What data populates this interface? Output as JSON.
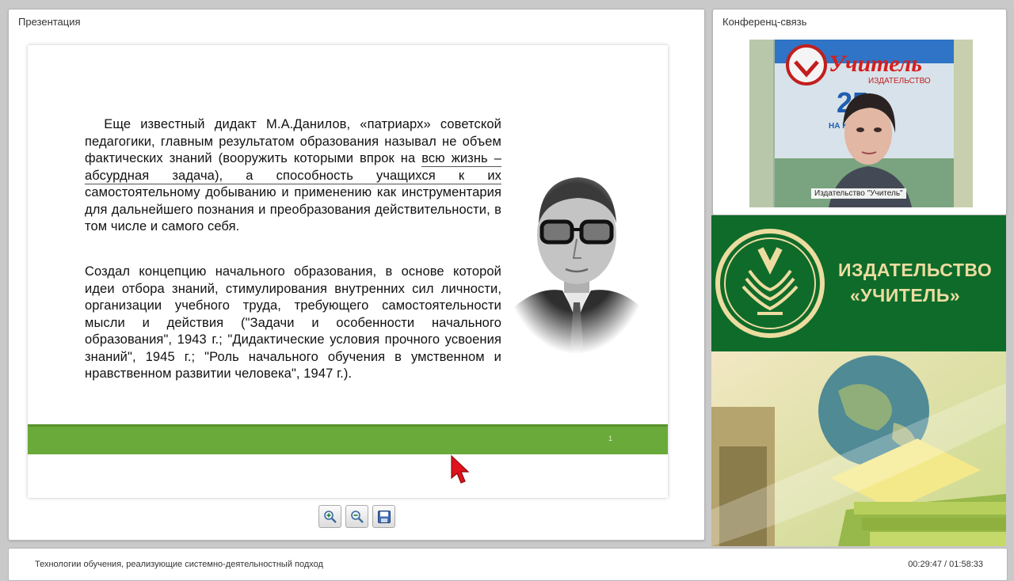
{
  "presentation": {
    "title": "Презентация",
    "slide": {
      "para1_line1": "Еще известный дидакт М.А.Данилов, «патриарх» советской педагогики, главным результатом образования называл не объем фактических знаний (вооружить которыми впрок на ",
      "para1_underlined": "всю жизнь – абсурдная задача), а способность учащихся к их",
      "para1_line2": " самостоятельному добыванию и применению как инструментария для дальнейшего познания и преобразования действительности, в том числе и самого себя.",
      "para2": "Создал концепцию начального образования, в основе которой идеи отбора знаний, стимулирования внутренних сил личности, организации учебного труда, требующего самостоятельности мысли и действия (\"Задачи и особенности начального образования\", 1943 г.; \"Дидактические условия прочного усвоения знаний\", 1945 г.; \"Роль начального обучения в умственном и нравственном развитии человека\", 1947 г.).",
      "bar_mark": "1",
      "accent_color": "#6aaa3a"
    },
    "toolbar": {
      "zoom_in_icon": "zoom-in-icon",
      "zoom_out_icon": "zoom-out-icon",
      "save_icon": "save-icon"
    }
  },
  "conference": {
    "title": "Конференц-связь",
    "video_label": "Издательство \"Учитель\"",
    "banner_brand": "Учитель",
    "banner_sub": "ИЗДАТЕЛЬСТВО",
    "banner_number": "25",
    "banner_tag": "НА КНИЖ"
  },
  "brand": {
    "line1": "ИЗДАТЕЛЬСТВО",
    "line2": "«УЧИТЕЛЬ»",
    "color": "#0f6b2a"
  },
  "status": {
    "course_title": "Технологии обучения, реализующие системно-деятельностный подход",
    "time": "00:29:47 / 01:58:33"
  }
}
